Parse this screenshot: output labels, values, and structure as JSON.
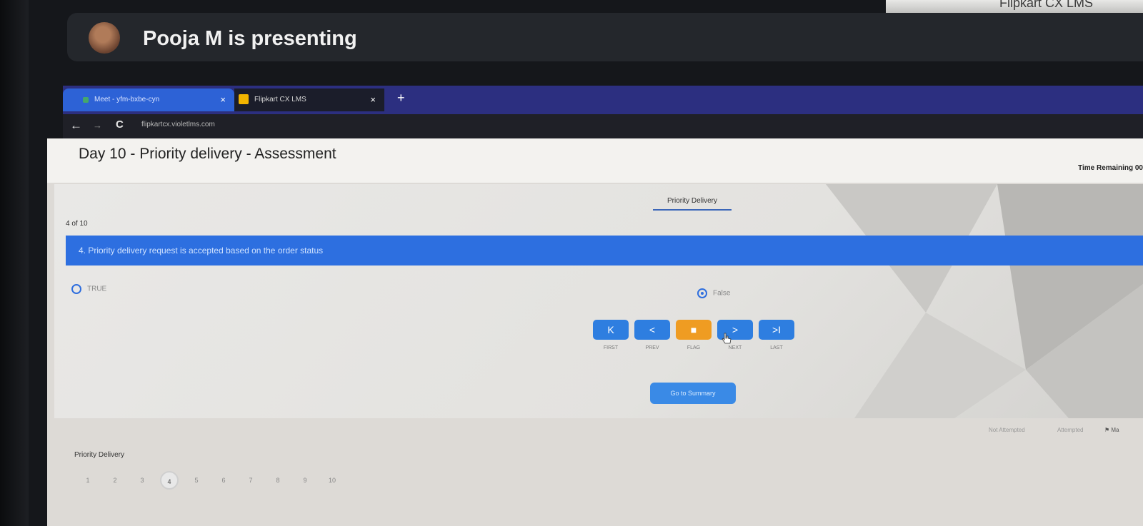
{
  "presenter": {
    "text": "Pooja M is presenting"
  },
  "screen_corner": {
    "text": "Flipkart CX LMS"
  },
  "browser": {
    "tabs": [
      {
        "label": "Meet - yfm-bxbe-cyn",
        "close": "×"
      },
      {
        "label": "Flipkart CX LMS",
        "close": "×"
      }
    ],
    "new_tab": "+",
    "back": "←",
    "forward": "→",
    "reload": "C",
    "url": "flipkartcx.violetlms.com"
  },
  "page": {
    "title": "Day 10 - Priority delivery - Assessment",
    "time_remaining": "Time Remaining 00",
    "section_tab": "Priority Delivery",
    "question_count": "4 of 10",
    "question": "4. Priority delivery request is accepted based on the order status",
    "options": [
      {
        "label": "TRUE",
        "selected": false
      },
      {
        "label": "False",
        "selected": true
      }
    ],
    "nav_buttons": [
      {
        "icon": "K",
        "label": "FIRST",
        "color": "#2e7ee0"
      },
      {
        "icon": "<",
        "label": "PREV",
        "color": "#2e7ee0"
      },
      {
        "icon": "■",
        "label": "FLAG",
        "color": "#ef9c22"
      },
      {
        "icon": ">",
        "label": "NEXT",
        "color": "#2e7ee0"
      },
      {
        "icon": ">I",
        "label": "LAST",
        "color": "#2e7ee0"
      }
    ],
    "summary_button": "Go to Summary",
    "legend": {
      "not_attempted": "Not Attempted",
      "attempted": "Attempted",
      "marked": "Ma"
    },
    "footer_section": "Priority Delivery",
    "question_numbers": [
      "1",
      "2",
      "3",
      "4",
      "5",
      "6",
      "7",
      "8",
      "9",
      "10"
    ],
    "current_question": 4
  }
}
